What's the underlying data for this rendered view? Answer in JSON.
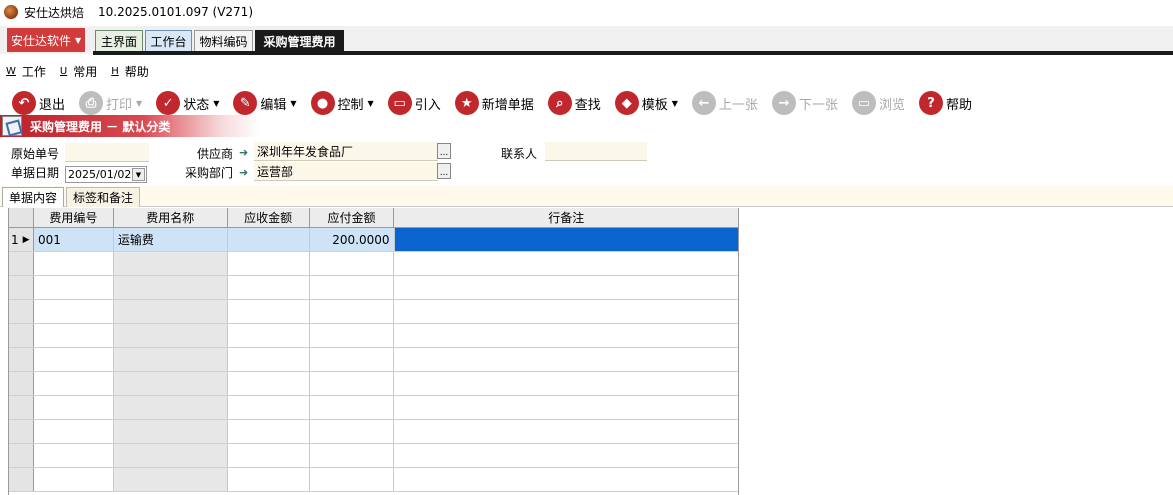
{
  "window": {
    "app_name": "安仕达烘焙",
    "version": "10.2025.0101.097 (V271)"
  },
  "tabbar": {
    "brand_label": "安仕达软件",
    "tabs": [
      {
        "label": "主界面"
      },
      {
        "label": "工作台"
      },
      {
        "label": "物料编码"
      },
      {
        "label": "采购管理费用"
      }
    ]
  },
  "menubar": {
    "items": [
      {
        "hotkey": "W",
        "label": "工作"
      },
      {
        "hotkey": "U",
        "label": "常用"
      },
      {
        "hotkey": "H",
        "label": "帮助"
      }
    ]
  },
  "toolbar": {
    "buttons": [
      {
        "label": "退出",
        "icon": "exit-icon",
        "glyph": "↶",
        "disabled": false,
        "dropdown": false
      },
      {
        "label": "打印",
        "icon": "print-icon",
        "glyph": "⎙",
        "disabled": true,
        "dropdown": true
      },
      {
        "label": "状态",
        "icon": "check-icon",
        "glyph": "✓",
        "disabled": false,
        "dropdown": true
      },
      {
        "label": "编辑",
        "icon": "pencil-icon",
        "glyph": "✎",
        "disabled": false,
        "dropdown": true
      },
      {
        "label": "控制",
        "icon": "user-icon",
        "glyph": "●",
        "disabled": false,
        "dropdown": true
      },
      {
        "label": "引入",
        "icon": "folder-open-icon",
        "glyph": "▭",
        "disabled": false,
        "dropdown": false
      },
      {
        "label": "新增单据",
        "icon": "star-icon",
        "glyph": "★",
        "disabled": false,
        "dropdown": false
      },
      {
        "label": "查找",
        "icon": "search-icon",
        "glyph": "⌕",
        "disabled": false,
        "dropdown": false
      },
      {
        "label": "模板",
        "icon": "eraser-icon",
        "glyph": "◆",
        "disabled": false,
        "dropdown": true
      },
      {
        "label": "上一张",
        "icon": "arrow-left-icon",
        "glyph": "←",
        "disabled": true,
        "dropdown": false
      },
      {
        "label": "下一张",
        "icon": "arrow-right-icon",
        "glyph": "→",
        "disabled": true,
        "dropdown": false
      },
      {
        "label": "浏览",
        "icon": "folder-icon",
        "glyph": "▭",
        "disabled": true,
        "dropdown": false
      },
      {
        "label": "帮助",
        "icon": "help-icon",
        "glyph": "?",
        "disabled": false,
        "dropdown": false
      }
    ]
  },
  "section": {
    "title": "采购管理费用 － 默认分类"
  },
  "form": {
    "source_no_label": "原始单号",
    "source_no_value": "",
    "date_label": "单据日期",
    "date_value": "2025/01/02",
    "supplier_label": "供应商",
    "supplier_value": "深圳年年发食品厂",
    "dept_label": "采购部门",
    "dept_value": "运营部",
    "contact_label": "联系人",
    "contact_value": "",
    "lookup_label": "..."
  },
  "subtabs": {
    "items": [
      {
        "label": "单据内容"
      },
      {
        "label": "标签和备注"
      }
    ]
  },
  "grid": {
    "columns": [
      "费用编号",
      "费用名称",
      "应收金额",
      "应付金额",
      "行备注"
    ],
    "rows": [
      {
        "index": "1",
        "code": "001",
        "name": "运输费",
        "receivable": "",
        "payable": "200.0000",
        "note": ""
      }
    ],
    "empty_rows": 10,
    "selection_color": "#0a64cf"
  },
  "colors": {
    "brand_red": "#d23b3b",
    "icon_red": "#c0282e",
    "field_bg": "#fbf8ea"
  }
}
